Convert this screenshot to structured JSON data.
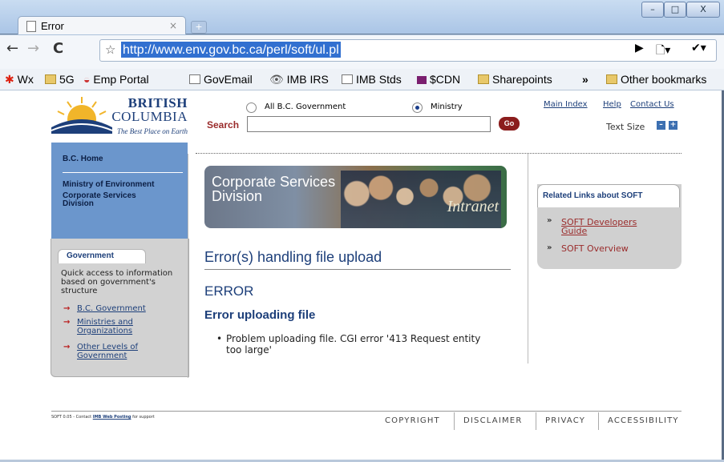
{
  "browser": {
    "tab_title": "Error",
    "tab_close": "×",
    "new_tab": "+",
    "window_buttons": [
      "–",
      "□",
      "X"
    ],
    "nav": {
      "back": "←",
      "forward": "→",
      "reload": "C",
      "star": "☆"
    },
    "url": "http://www.env.gov.bc.ca/perl/soft/ul.pl",
    "right_icons": {
      "go": "▶",
      "page": "🗋▾",
      "wrench": "✔▾"
    },
    "bookmarks": [
      "Wx",
      "5G",
      "Emp Portal",
      "GovEmail",
      "IMB IRS",
      "IMB Stds",
      "$CDN",
      "Sharepoints"
    ],
    "bookmarks_overflow": "»",
    "other_bookmarks": "Other bookmarks"
  },
  "header": {
    "logo": {
      "line1": "BRITISH",
      "line2": "COLUMBIA",
      "tagline": "The Best Place on Earth"
    },
    "radio_all": "All B.C. Government",
    "radio_ministry": "Ministry",
    "search_label": "Search",
    "search_value": "",
    "go_label": "Go",
    "top_links": [
      "Main Index",
      "Help",
      "Contact Us"
    ],
    "text_size_label": "Text Size",
    "text_size_minus": "–",
    "text_size_plus": "+"
  },
  "left_nav": {
    "home": "B.C. Home",
    "ministry": "Ministry of Environment",
    "division": "Corporate Services Division",
    "gov_tab": "Government",
    "quick_text": "Quick access to information based on government's structure",
    "links": [
      "B.C. Government",
      "Ministries and Organizations",
      "Other Levels of Government"
    ],
    "arrow": "→"
  },
  "main": {
    "banner_title": "Corporate Services Division",
    "banner_intranet": "Intranet",
    "heading": "Error(s) handling file upload",
    "error_label": "ERROR",
    "error_sub": "Error uploading file",
    "bullet": "•",
    "error_item": "Problem uploading file. CGI error '413 Request entity too large'"
  },
  "related": {
    "title": "Related Links about SOFT",
    "arrow": "»",
    "links": [
      "SOFT Developers Guide",
      "SOFT Overview"
    ]
  },
  "footer": {
    "left_prefix": "SOFT 0.05 - Contact",
    "left_link": "IMB Web Posting",
    "left_suffix": "for support",
    "links": [
      "COPYRIGHT",
      "DISCLAIMER",
      "PRIVACY",
      "ACCESSIBILITY"
    ]
  }
}
